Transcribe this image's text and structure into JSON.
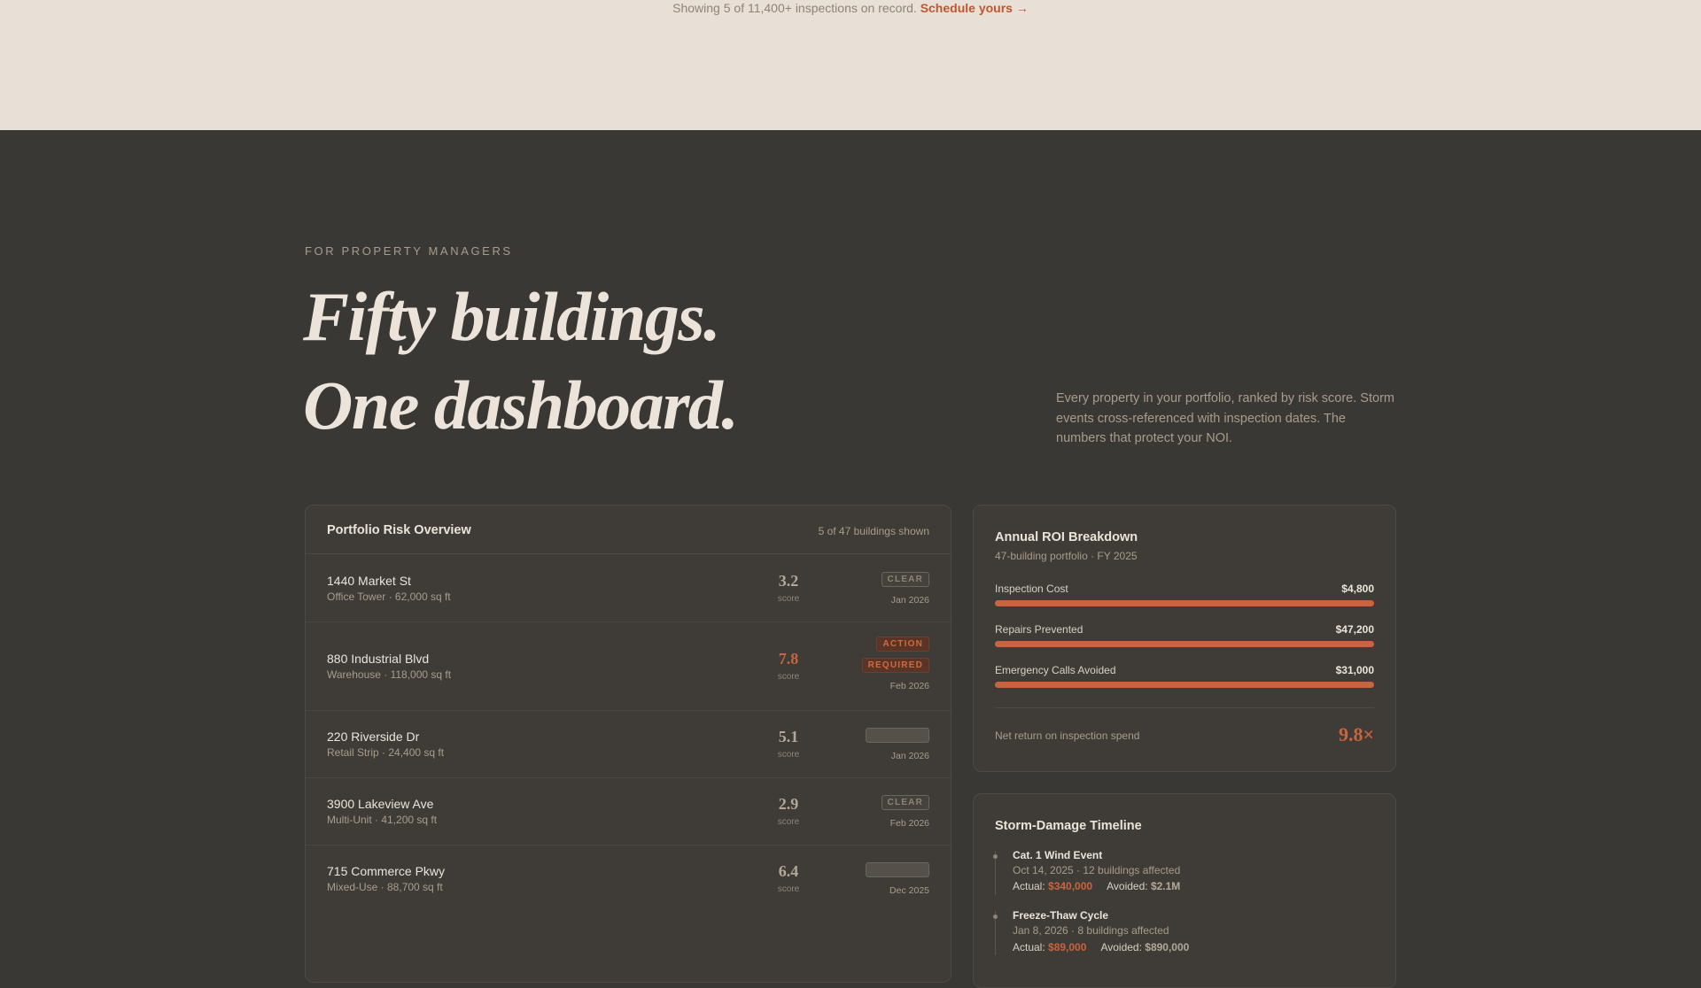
{
  "top_note": {
    "text": "Showing 5 of 11,400+ inspections on record. ",
    "cta": "Schedule yours →"
  },
  "hero": {
    "eyebrow": "FOR PROPERTY MANAGERS",
    "headline_line1": "Fifty buildings.",
    "headline_line2": "One dashboard.",
    "intro": "Every property in your portfolio, ranked by risk score. Storm events cross-referenced with inspection dates. The numbers that protect your NOI."
  },
  "risk_panel": {
    "title": "Portfolio Risk Overview",
    "count": "5 of 47 buildings shown",
    "score_label": "score",
    "rows": [
      {
        "name": "1440 Market St",
        "meta": "Office Tower · 62,000 sq ft",
        "score": "3.2",
        "status": "CLEAR",
        "date": "Jan 2026"
      },
      {
        "name": "880 Industrial Blvd",
        "meta": "Warehouse · 118,000 sq ft",
        "score": "7.8",
        "status_line1": "ACTION",
        "status_line2": "REQUIRED",
        "date": "Feb 2026"
      },
      {
        "name": "220 Riverside Dr",
        "meta": "Retail Strip · 24,400 sq ft",
        "score": "5.1",
        "status": "",
        "date": "Jan 2026"
      },
      {
        "name": "3900 Lakeview Ave",
        "meta": "Multi-Unit · 41,200 sq ft",
        "score": "2.9",
        "status": "CLEAR",
        "date": "Feb 2026"
      },
      {
        "name": "715 Commerce Pkwy",
        "meta": "Mixed-Use · 88,700 sq ft",
        "score": "6.4",
        "status": "",
        "date": "Dec 2025"
      }
    ]
  },
  "roi_panel": {
    "title": "Annual ROI Breakdown",
    "subtitle": "47-building portfolio · FY 2025",
    "items": [
      {
        "label": "Inspection Cost",
        "value": "$4,800",
        "fill_fraction": 1.0
      },
      {
        "label": "Repairs Prevented",
        "value": "$47,200",
        "fill_fraction": 1.0
      },
      {
        "label": "Emergency Calls Avoided",
        "value": "$31,000",
        "fill_fraction": 1.0
      }
    ],
    "net_label": "Net return on inspection spend",
    "net_value": "9.8×"
  },
  "storm_panel": {
    "title": "Storm-Damage Timeline",
    "actual_label": "Actual:",
    "avoided_label": "Avoided:",
    "events": [
      {
        "name": "Cat. 1 Wind Event",
        "meta": "Oct 14, 2025 · 12 buildings affected",
        "actual": "$340,000",
        "avoided": "$2.1M"
      },
      {
        "name": "Freeze-Thaw Cycle",
        "meta": "Jan 8, 2026 · 8 buildings affected",
        "actual": "$89,000",
        "avoided": "$890,000"
      }
    ]
  },
  "colors": {
    "accent": "#c8643e",
    "light_band": "#e8e0d6",
    "dark_bg": "#3a3834",
    "panel_bg": "#3f3c37"
  }
}
